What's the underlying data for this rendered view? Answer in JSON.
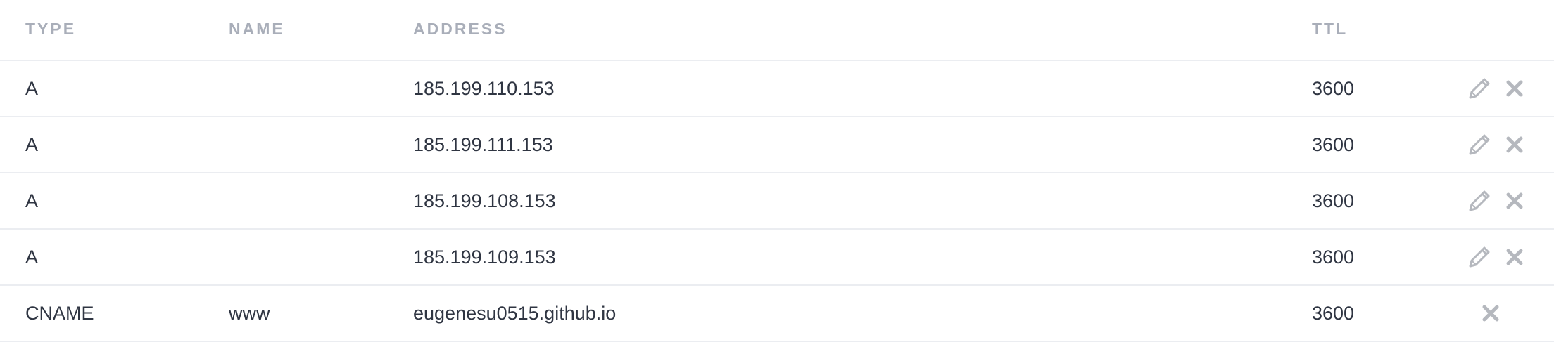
{
  "table": {
    "headers": {
      "type": "TYPE",
      "name": "NAME",
      "address": "ADDRESS",
      "ttl": "TTL"
    },
    "rows": [
      {
        "type": "A",
        "name": "",
        "address": "185.199.110.153",
        "ttl": "3600",
        "editable": true
      },
      {
        "type": "A",
        "name": "",
        "address": "185.199.111.153",
        "ttl": "3600",
        "editable": true
      },
      {
        "type": "A",
        "name": "",
        "address": "185.199.108.153",
        "ttl": "3600",
        "editable": true
      },
      {
        "type": "A",
        "name": "",
        "address": "185.199.109.153",
        "ttl": "3600",
        "editable": true
      },
      {
        "type": "CNAME",
        "name": "www",
        "address": "eugenesu0515.github.io",
        "ttl": "3600",
        "editable": false
      }
    ]
  },
  "icons": {
    "edit": "pencil-icon",
    "delete": "close-icon"
  },
  "colors": {
    "header_text": "#a9aeb9",
    "body_text": "#2f3542",
    "divider": "#ebedf1",
    "icon": "#b5b8be"
  }
}
